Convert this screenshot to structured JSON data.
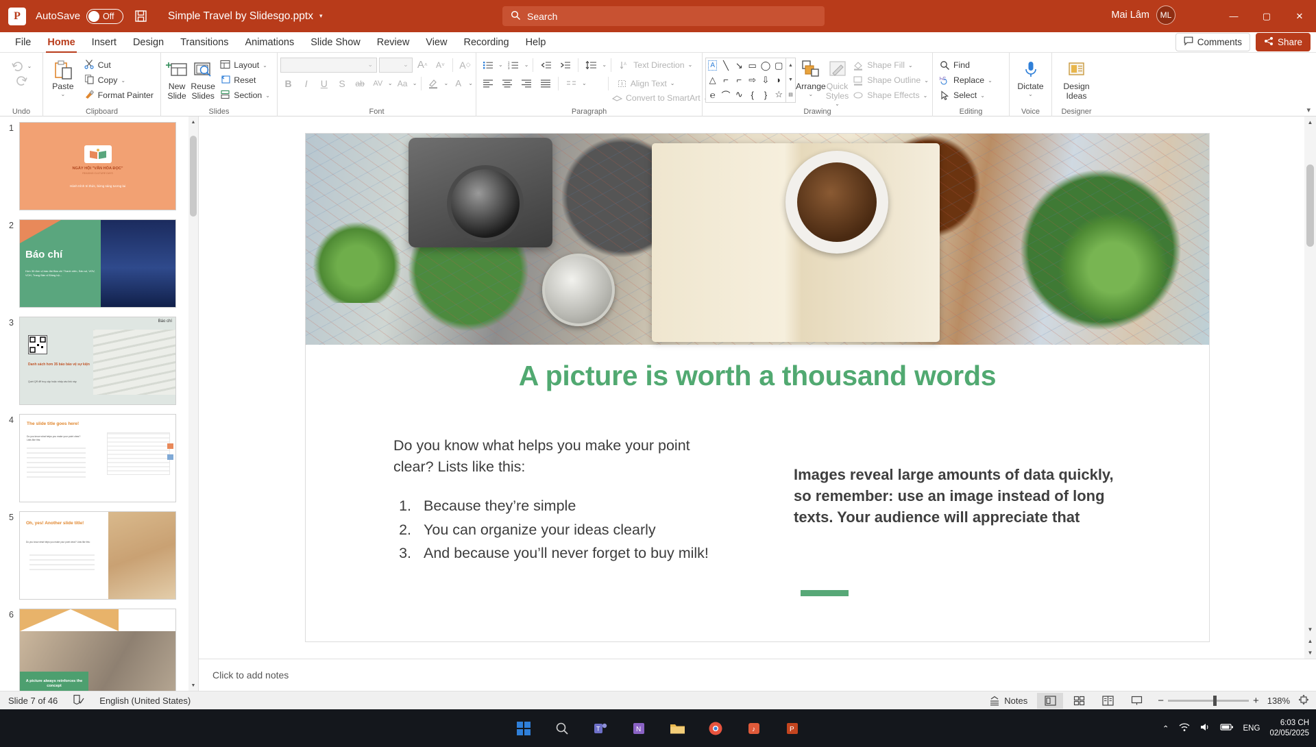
{
  "titlebar": {
    "app_icon": "powerpoint-logo-icon",
    "autosave_label": "AutoSave",
    "autosave_state": "Off",
    "save_icon": "save-icon",
    "document_title": "Simple Travel by Slidesgo.pptx",
    "title_caret": "▾",
    "search_placeholder": "Search",
    "search_icon": "search-icon",
    "user_name": "Mai Lâm",
    "user_initials": "ML",
    "minimize": "—",
    "maximize": "▢",
    "close": "✕",
    "accent_color": "#b83b1a"
  },
  "menubar": {
    "items": [
      {
        "label": "File",
        "active": false
      },
      {
        "label": "Home",
        "active": true
      },
      {
        "label": "Insert",
        "active": false
      },
      {
        "label": "Design",
        "active": false
      },
      {
        "label": "Transitions",
        "active": false
      },
      {
        "label": "Animations",
        "active": false
      },
      {
        "label": "Slide Show",
        "active": false
      },
      {
        "label": "Review",
        "active": false
      },
      {
        "label": "View",
        "active": false
      },
      {
        "label": "Recording",
        "active": false
      },
      {
        "label": "Help",
        "active": false
      }
    ],
    "comments_label": "Comments",
    "share_label": "Share"
  },
  "ribbon": {
    "groups": {
      "undo": {
        "label": "Undo",
        "undo_label": "Undo",
        "redo_label": "Redo"
      },
      "clipboard": {
        "label": "Clipboard",
        "paste_label": "Paste",
        "cut_label": "Cut",
        "copy_label": "Copy",
        "format_painter_label": "Format Painter"
      },
      "slides": {
        "label": "Slides",
        "new_slide_label": "New\nSlide",
        "new_slide_line1": "New",
        "new_slide_line2": "Slide",
        "reuse_slides_line1": "Reuse",
        "reuse_slides_line2": "Slides",
        "layout_label": "Layout",
        "reset_label": "Reset",
        "section_label": "Section"
      },
      "font": {
        "label": "Font",
        "font_name_value": "",
        "font_size_value": "",
        "bold": "B",
        "italic": "I",
        "underline": "U",
        "shadow": "S",
        "strikethrough": "ab",
        "char_spacing": "AV",
        "change_case": "Aa",
        "increase_size": "A",
        "decrease_size": "A",
        "clear_formatting": "A",
        "text_highlight": "highlight-icon",
        "font_color": "A"
      },
      "paragraph": {
        "label": "Paragraph",
        "bullets": "bullets-icon",
        "numbering": "numbering-icon",
        "decrease_indent": "decrease-indent-icon",
        "increase_indent": "increase-indent-icon",
        "line_spacing": "line-spacing-icon",
        "align_left": "align-left-icon",
        "align_center": "align-center-icon",
        "align_right": "align-right-icon",
        "justify": "justify-icon",
        "columns": "columns-icon",
        "text_direction_label": "Text Direction",
        "align_text_label": "Align Text",
        "smartart_label": "Convert to SmartArt"
      },
      "drawing": {
        "label": "Drawing",
        "shapes": [
          "A",
          "╲",
          "↘",
          "▭",
          "◯",
          "▭",
          "△",
          "⌐",
          "⌐",
          "⇨",
          "⇩",
          "◗",
          "℮",
          "⌒",
          "∿",
          "{",
          "}",
          "☆"
        ],
        "arrange_label": "Arrange",
        "quick_styles_line1": "Quick",
        "quick_styles_line2": "Styles",
        "shape_fill_label": "Shape Fill",
        "shape_outline_label": "Shape Outline",
        "shape_effects_label": "Shape Effects"
      },
      "editing": {
        "label": "Editing",
        "find_label": "Find",
        "replace_label": "Replace",
        "select_label": "Select"
      },
      "voice": {
        "label": "Voice",
        "dictate_label": "Dictate"
      },
      "designer": {
        "label": "Designer",
        "design_ideas_line1": "Design",
        "design_ideas_line2": "Ideas"
      }
    },
    "collapse_icon": "▾"
  },
  "thumbnails": [
    {
      "number": "1",
      "selected": false,
      "title": "NGÀY HỘI \"VĂN HÓA ĐỌC\"",
      "subtitle": "READING CULTURE DAYS",
      "caption": "Hành trình tri thức, bừng sáng tương lai"
    },
    {
      "number": "2",
      "selected": false,
      "title": "Báo chí",
      "caption": "Hơn 30 đơn vị báo đài Báo chí Thanh niên, Sản số, VOV, VOH, Trang Bản sĩ Đảng bộ..."
    },
    {
      "number": "3",
      "selected": false,
      "title": "Báo chí",
      "heading": "Danh sách hơn 35 báo bảo vệ sự kiện",
      "caption": "Quét QR để truy cập hoặc nhấp vào link này"
    },
    {
      "number": "4",
      "selected": false,
      "title": "The slide title goes here!",
      "caption": "Do you know what helps you make your point clear? Lists like this:"
    },
    {
      "number": "5",
      "selected": false,
      "title": "Oh, yes! Another slide title!",
      "caption": "Do you know what helps you make your point clear? Lists like this:"
    },
    {
      "number": "6",
      "selected": false,
      "title": "A picture always reinforces the concept"
    }
  ],
  "thumb_scroll": {
    "up": "▲",
    "down": "▼"
  },
  "slide": {
    "title": "A picture is worth a thousand words",
    "title_color": "#51a971",
    "left_intro": "Do you know what helps you make your point clear? Lists like this:",
    "list": [
      "Because they’re simple",
      "You can organize your ideas clearly",
      "And because you’ll never forget to buy milk!"
    ],
    "right_body": "Images reveal large amounts of data quickly, so remember: use an image instead of long texts. Your audience will appreciate that",
    "accent_bar_color": "#57a877",
    "photo_alt": "travel-flatlay-photo"
  },
  "slide_scroll": {
    "up": "▲",
    "down": "▼",
    "double_down": "⏷"
  },
  "notes": {
    "placeholder": "Click to add notes"
  },
  "statusbar": {
    "slide_counter": "Slide 7 of 46",
    "accessibility_icon": "accessibility-icon",
    "language": "English (United States)",
    "notes_label": "Notes",
    "views": [
      {
        "name": "normal-view",
        "icon": "▣",
        "active": true
      },
      {
        "name": "slide-sorter-view",
        "icon": "▦",
        "active": false
      },
      {
        "name": "reading-view",
        "icon": "▤",
        "active": false
      },
      {
        "name": "slide-show-view",
        "icon": "⎚",
        "active": false
      }
    ],
    "zoom_out": "−",
    "zoom_in": "+",
    "zoom_level": "138%",
    "fit_icon": "fit-to-window-icon"
  },
  "taskbar": {
    "icons": [
      {
        "name": "windows-start-icon",
        "glyph": "⊞",
        "color": "#2f7fd8"
      },
      {
        "name": "search-icon",
        "glyph": "◯",
        "color": "#cfcfcf"
      },
      {
        "name": "teams-icon",
        "glyph": "▣",
        "color": "#6d6fc7"
      },
      {
        "name": "onenote-icon",
        "glyph": "✎",
        "color": "#8a62c4"
      },
      {
        "name": "file-explorer-icon",
        "glyph": "▤",
        "color": "#e8b64c"
      },
      {
        "name": "chrome-icon",
        "glyph": "◉",
        "color": "#e8543f"
      },
      {
        "name": "music-icon",
        "glyph": "♪",
        "color": "#e05a3a"
      },
      {
        "name": "powerpoint-icon",
        "glyph": "P",
        "color": "#c4451f"
      }
    ],
    "tray": [
      {
        "name": "show-hidden-icons",
        "glyph": "⌃"
      },
      {
        "name": "speaker-icon",
        "glyph": "🔊"
      },
      {
        "name": "wifi-icon",
        "glyph": "📶"
      },
      {
        "name": "battery-icon",
        "glyph": "▭"
      },
      {
        "name": "language-indicator",
        "glyph": "ENG"
      }
    ],
    "time": "6:03 CH",
    "date": "02/05/2025"
  }
}
